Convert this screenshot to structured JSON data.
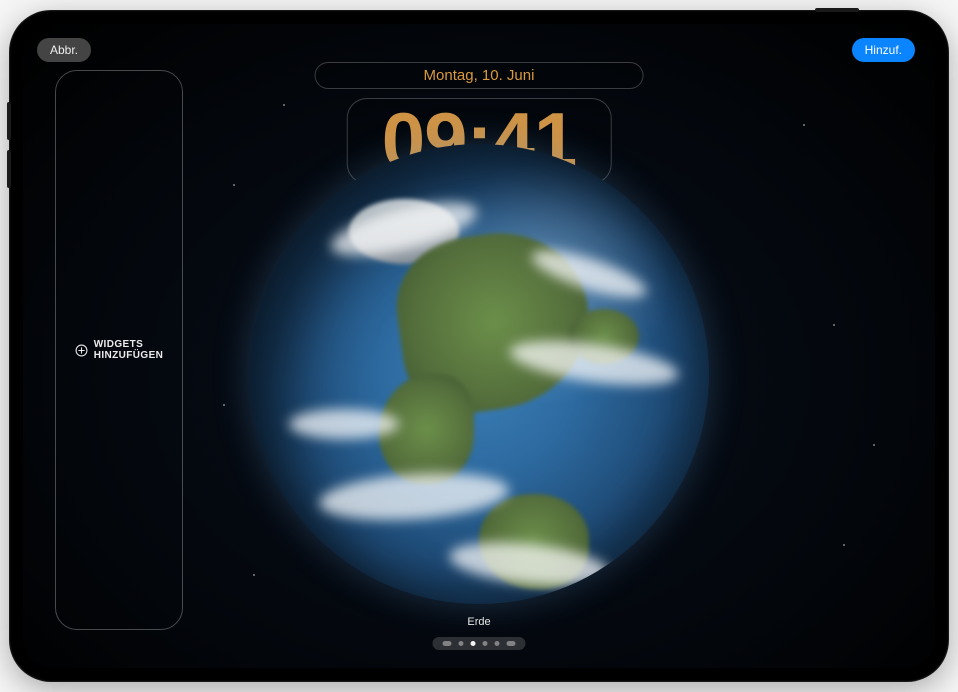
{
  "buttons": {
    "cancel": "Abbr.",
    "add": "Hinzuf."
  },
  "lockscreen": {
    "date": "Montag, 10. Juni",
    "time": "09:41"
  },
  "widgets": {
    "add_label": "WIDGETS\nHINZUFÜGEN"
  },
  "wallpaper": {
    "name": "Erde"
  },
  "pager": {
    "total": 6,
    "active_index": 2
  }
}
